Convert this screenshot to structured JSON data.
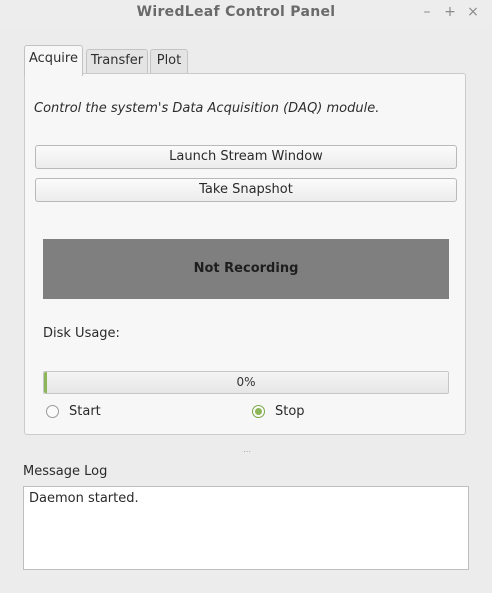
{
  "window": {
    "title": "WiredLeaf Control Panel",
    "minimize_glyph": "–",
    "maximize_glyph": "+",
    "close_glyph": "×"
  },
  "tabs": [
    {
      "label": "Acquire",
      "active": true
    },
    {
      "label": "Transfer",
      "active": false
    },
    {
      "label": "Plot",
      "active": false
    }
  ],
  "acquire": {
    "description": "Control the system's Data Acquisition (DAQ) module.",
    "launch_stream_label": "Launch Stream Window",
    "take_snapshot_label": "Take Snapshot",
    "status_text": "Not Recording",
    "disk_usage_label": "Disk Usage:",
    "disk_usage_percent": 0,
    "disk_usage_text": "0%",
    "radio_start_label": "Start",
    "radio_stop_label": "Stop",
    "selected_mode": "Stop"
  },
  "log": {
    "label": "Message Log",
    "content": "Daemon started."
  },
  "colors": {
    "accent": "#8db65a",
    "status_background": "#7f7f7f"
  },
  "icons": {
    "minimize": "minimize-icon",
    "maximize": "maximize-icon",
    "close": "close-icon",
    "splitter": "splitter-handle-icon"
  }
}
